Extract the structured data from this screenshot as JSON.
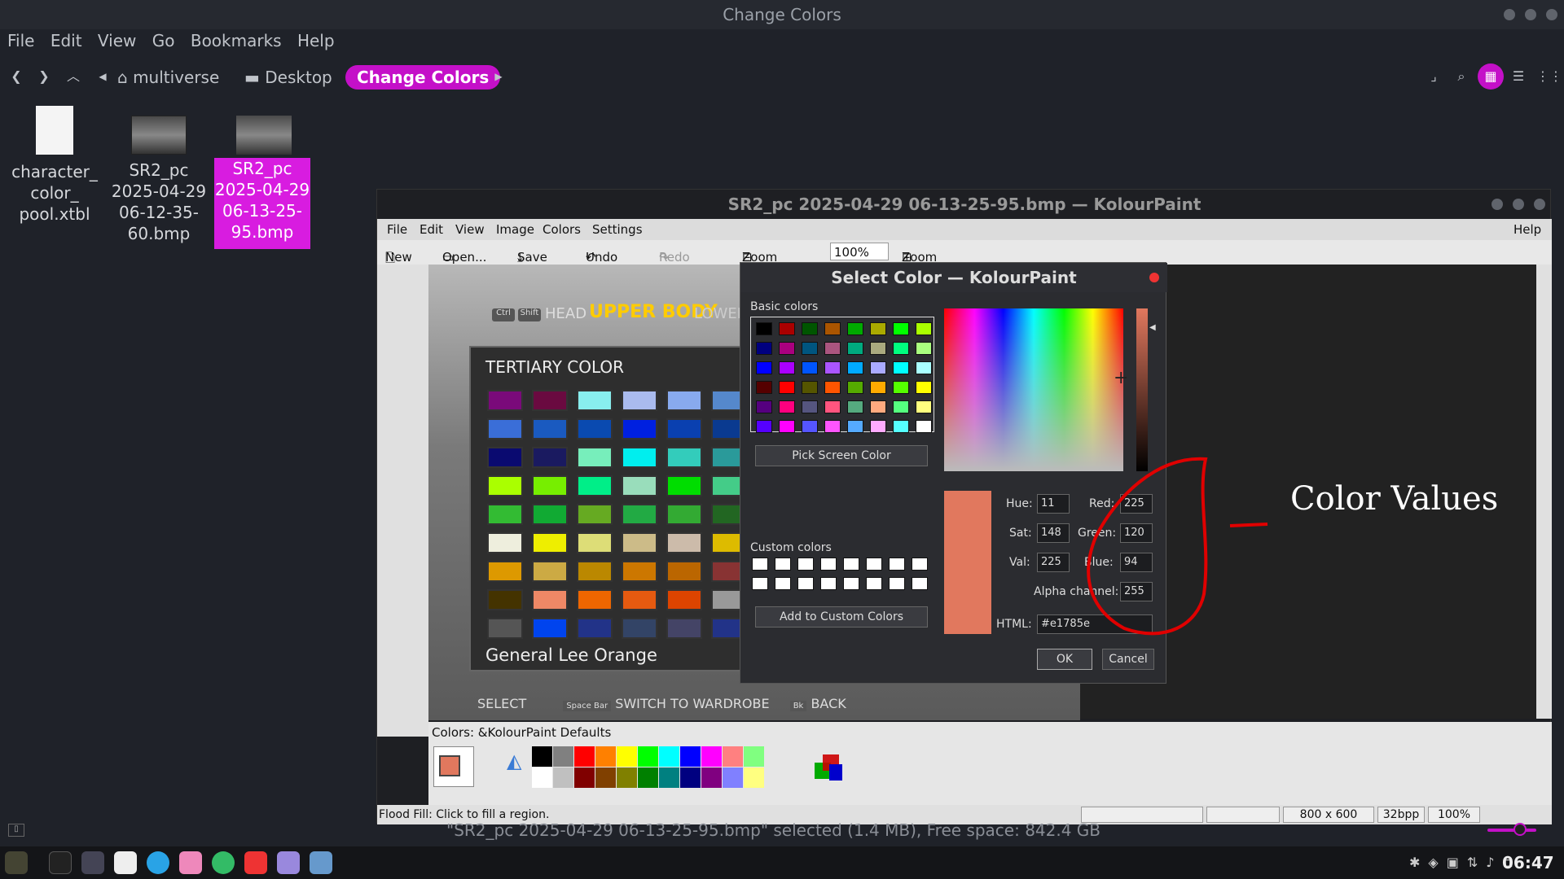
{
  "window": {
    "title": "Change Colors"
  },
  "menubar": [
    "File",
    "Edit",
    "View",
    "Go",
    "Bookmarks",
    "Help"
  ],
  "path": {
    "home": "multiverse",
    "desktop": "Desktop",
    "current": "Change Colors"
  },
  "files": [
    {
      "name": "character_\ncolor_\npool.xtbl",
      "type": "document-icon"
    },
    {
      "name": "SR2_pc\n2025-04-29\n06-12-35-\n60.bmp",
      "type": "image-thumb"
    },
    {
      "name": "SR2_pc\n2025-04-29\n06-13-25-\n95.bmp",
      "type": "image-thumb",
      "selected": true
    }
  ],
  "kolourpaint": {
    "title": "SR2_pc 2025-04-29 06-13-25-95.bmp  — KolourPaint",
    "menu": [
      "File",
      "Edit",
      "View",
      "Image",
      "Colors",
      "Settings"
    ],
    "help": "Help",
    "toolbar": {
      "new": "New",
      "open": "Open...",
      "save": "Save",
      "undo": "Undo",
      "redo": "Redo",
      "zoom_out": "Zoom Out",
      "zoom_value": "100%",
      "zoom_in": "Zoom In"
    },
    "colors_label": "Colors: &KolourPaint Defaults",
    "status": {
      "message": "Flood Fill: Click to fill a region.",
      "size": "800 x 600",
      "depth": "32bpp",
      "zoom": "100%"
    }
  },
  "game": {
    "tabs": {
      "ctrl": "Ctrl",
      "shift": "Shift",
      "head": "HEAD",
      "upper": "UPPER BODY",
      "lower": "LOWER"
    },
    "panel_title": "TERTIARY COLOR",
    "selected_name": "General Lee Orange",
    "footer": {
      "select": "SELECT",
      "spacebar": "Space Bar",
      "switch": "SWITCH TO WARDROBE",
      "bk": "Bk",
      "back": "BACK"
    }
  },
  "dialog": {
    "title": "Select Color — KolourPaint",
    "basic_label": "Basic colors",
    "pick_screen": "Pick Screen Color",
    "custom_label": "Custom colors",
    "add_custom": "Add to Custom Colors",
    "hue_label": "Hue:",
    "hue": "11",
    "sat_label": "Sat:",
    "sat": "148",
    "val_label": "Val:",
    "val": "225",
    "red_label": "Red:",
    "red": "225",
    "green_label": "Green:",
    "green": "120",
    "blue_label": "Blue:",
    "blue": "94",
    "alpha_label": "Alpha channel:",
    "alpha": "255",
    "html_label": "HTML:",
    "html": "#e1785e",
    "ok": "OK",
    "cancel": "Cancel",
    "current_color": "#e1785e"
  },
  "annotation": "Color  Values",
  "status_line": "\"SR2_pc 2025-04-29 06-13-25-95.bmp\" selected (1.4 MB), Free space: 842.4 GB",
  "clock": "06:47",
  "colors": {
    "accent": "#c410c8",
    "selected_file": "#d81ce0",
    "annotation_red": "#e00000"
  }
}
